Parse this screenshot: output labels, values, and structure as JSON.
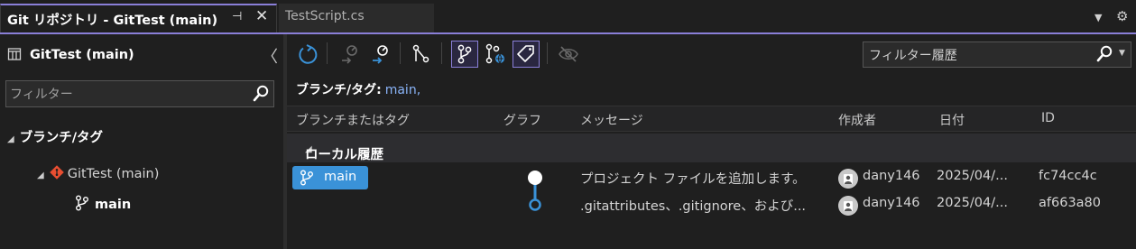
{
  "tabs": {
    "active_title": "Git リポジトリ - GitTest (main)",
    "pin_glyph": "⊣",
    "close_glyph": "✕",
    "second_title": "TestScript.cs",
    "menu_glyph": "▼",
    "settings_glyph": "⚙"
  },
  "left": {
    "repo_title": "GitTest (main)",
    "collapse_glyph": "〈",
    "search_placeholder": "フィルター",
    "tree_header": "ブランチ/タグ",
    "repo_node": "GitTest (main)",
    "branch_node": "main",
    "expand_glyph": "◢"
  },
  "toolbar": {
    "search_placeholder": "フィルター履歴",
    "dropdown_glyph": "▼"
  },
  "filter": {
    "label": "ブランチ/タグ:",
    "value": "main,"
  },
  "columns": {
    "branch": "ブランチまたはタグ",
    "graph": "グラフ",
    "message": "メッセージ",
    "author": "作成者",
    "date": "日付",
    "id": "ID"
  },
  "group": {
    "title": "ローカル履歴",
    "expand_glyph": "◢"
  },
  "commits": [
    {
      "branch": "main",
      "message": "プロジェクト ファイルを追加します。",
      "author": "dany146",
      "date": "2025/04/...",
      "id": "fc74cc4c"
    },
    {
      "branch": "",
      "message": ".gitattributes、.gitignore、および...",
      "author": "dany146",
      "date": "2025/04/...",
      "id": "af663a80"
    }
  ],
  "colors": {
    "accent": "#8a7fd8",
    "branch_chip": "#3a92d8",
    "graph_line": "#3a92d8",
    "link_blue": "#8ab4f8",
    "git_logo": "#e84e31"
  }
}
